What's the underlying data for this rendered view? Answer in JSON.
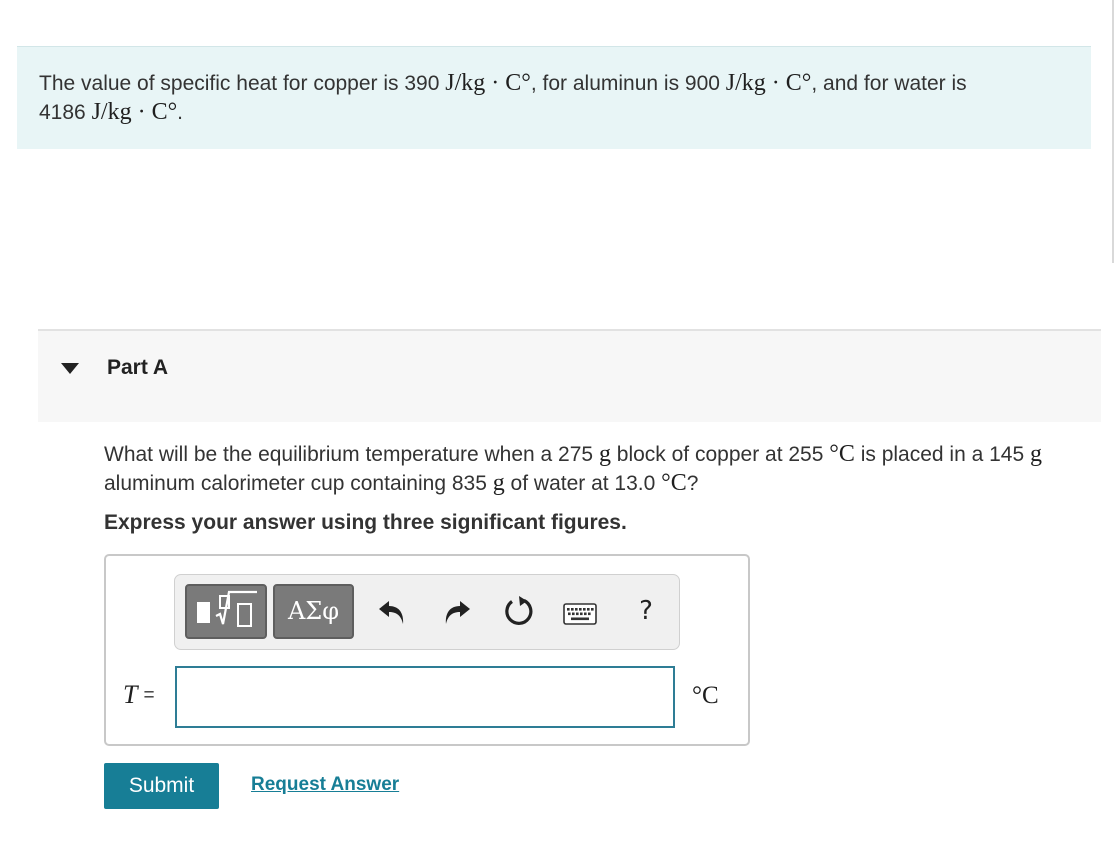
{
  "problem": {
    "text_1": "The value of specific heat for copper is 390 ",
    "unit_1": "J/kg · C°",
    "text_2": ", for aluminun is 900 ",
    "unit_2": "J/kg · C°",
    "text_3": ", and for water is",
    "text_4": "4186 ",
    "unit_3": "J/kg · C°",
    "text_5": "."
  },
  "part": {
    "title": "Part A"
  },
  "question": {
    "text_1": "What will be the equilibrium temperature when a 275 ",
    "unit_g1": "g",
    "text_2": " block of copper at 255 ",
    "unit_c1": "°C",
    "text_3": " is placed in a 145 ",
    "unit_g2": "g",
    "text_4": "aluminum calorimeter cup containing 835 ",
    "unit_g3": "g",
    "text_5": " of water at 13.0 ",
    "unit_c2": "°C",
    "text_6": "?"
  },
  "instruction": "Express your answer using three significant figures.",
  "answer": {
    "variable": "T",
    "equals": "=",
    "value": "",
    "unit": "°C"
  },
  "toolbar": {
    "symbols_label": "ΑΣφ",
    "help_label": "?",
    "icons": [
      "templates-icon",
      "undo-icon",
      "redo-icon",
      "reset-icon",
      "keyboard-icon",
      "help-icon"
    ]
  },
  "buttons": {
    "submit": "Submit",
    "request_answer": "Request Answer"
  },
  "colors": {
    "info_background": "#e8f5f6",
    "accent": "#177e96",
    "input_border": "#2e7d95"
  }
}
